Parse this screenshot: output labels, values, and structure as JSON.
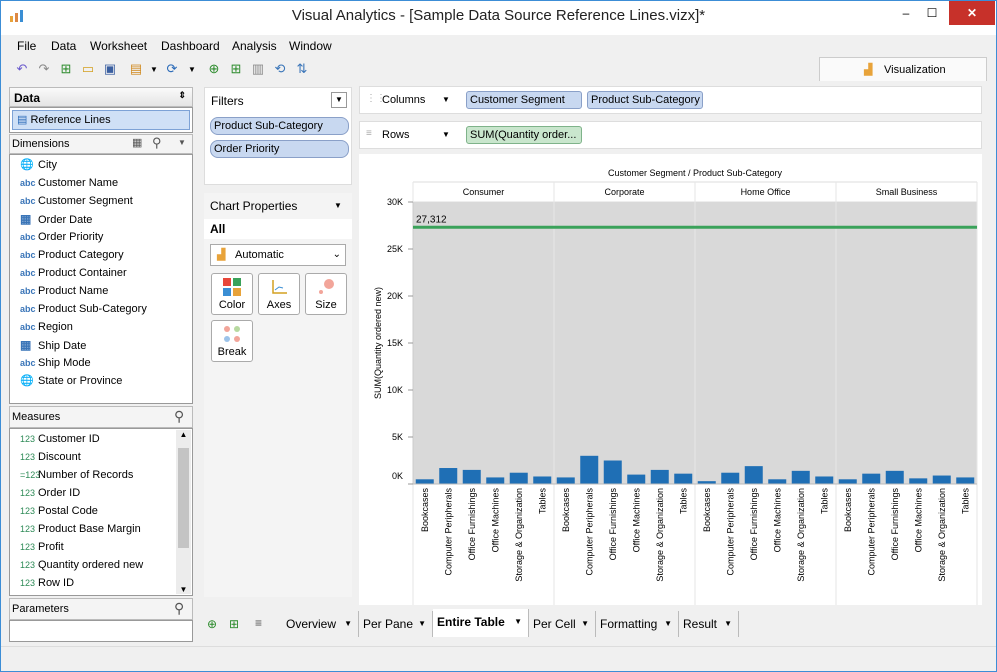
{
  "app": {
    "title": "Visual Analytics - [Sample Data Source Reference Lines.vizx]*"
  },
  "menu": [
    "File",
    "Data",
    "Worksheet",
    "Dashboard",
    "Analysis",
    "Window"
  ],
  "viz_tab": "Visualization",
  "data_panel": {
    "header": "Data",
    "source": "Reference Lines"
  },
  "dimensions": {
    "header": "Dimensions",
    "items": [
      {
        "type": "geo",
        "label": "City"
      },
      {
        "type": "abc",
        "label": "Customer Name"
      },
      {
        "type": "abc",
        "label": "Customer Segment"
      },
      {
        "type": "date",
        "label": "Order Date"
      },
      {
        "type": "abc",
        "label": "Order Priority"
      },
      {
        "type": "abc",
        "label": "Product Category"
      },
      {
        "type": "abc",
        "label": "Product Container"
      },
      {
        "type": "abc",
        "label": "Product Name"
      },
      {
        "type": "abc",
        "label": "Product Sub-Category"
      },
      {
        "type": "abc",
        "label": "Region"
      },
      {
        "type": "date",
        "label": "Ship Date"
      },
      {
        "type": "abc",
        "label": "Ship Mode"
      },
      {
        "type": "geo",
        "label": "State or Province"
      }
    ]
  },
  "measures": {
    "header": "Measures",
    "items": [
      {
        "type": "123",
        "label": "Customer ID"
      },
      {
        "type": "123",
        "label": "Discount"
      },
      {
        "type": "=123",
        "label": "Number of Records"
      },
      {
        "type": "123",
        "label": "Order ID"
      },
      {
        "type": "123",
        "label": "Postal Code"
      },
      {
        "type": "123",
        "label": "Product Base Margin"
      },
      {
        "type": "123",
        "label": "Profit"
      },
      {
        "type": "123",
        "label": "Quantity ordered new"
      },
      {
        "type": "123",
        "label": "Row ID"
      }
    ]
  },
  "parameters": {
    "header": "Parameters"
  },
  "filters": {
    "header": "Filters",
    "items": [
      "Product Sub-Category",
      "Order Priority"
    ]
  },
  "chart_props": {
    "header": "Chart Properties",
    "scope": "All",
    "mark_type": "Automatic",
    "cards": [
      "Color",
      "Axes",
      "Size",
      "Break"
    ]
  },
  "shelves": {
    "columns_label": "Columns",
    "columns": [
      "Customer Segment",
      "Product Sub-Category"
    ],
    "rows_label": "Rows",
    "rows": [
      "SUM(Quantity order..."
    ]
  },
  "bottom_tabs": [
    "Overview",
    "Per Pane",
    "Entire Table",
    "Per Cell",
    "Formatting",
    "Result"
  ],
  "active_tab": "Entire Table",
  "chart_data": {
    "type": "bar",
    "title": "Customer Segment / Product Sub-Category",
    "ylabel": "SUM(Quantity ordered new)",
    "ylim": [
      0,
      30000
    ],
    "yticks": [
      "30K",
      "25K",
      "20K",
      "15K",
      "10K",
      "5K",
      "0K"
    ],
    "reference_line": {
      "value": 27312,
      "label": "27,312",
      "color": "#3aa25a"
    },
    "bar_color": "#1f6fb5",
    "categories": [
      "Bookcases",
      "Computer Peripherals",
      "Office Furnishings",
      "Office Machines",
      "Storage & Organization",
      "Tables"
    ],
    "series": [
      {
        "name": "Consumer",
        "values": [
          500,
          1700,
          1500,
          700,
          1200,
          800
        ]
      },
      {
        "name": "Corporate",
        "values": [
          700,
          3000,
          2500,
          1000,
          1500,
          1100
        ]
      },
      {
        "name": "Home Office",
        "values": [
          300,
          1200,
          1900,
          500,
          1400,
          800
        ]
      },
      {
        "name": "Small Business",
        "values": [
          500,
          1100,
          1400,
          600,
          900,
          700
        ]
      }
    ]
  }
}
